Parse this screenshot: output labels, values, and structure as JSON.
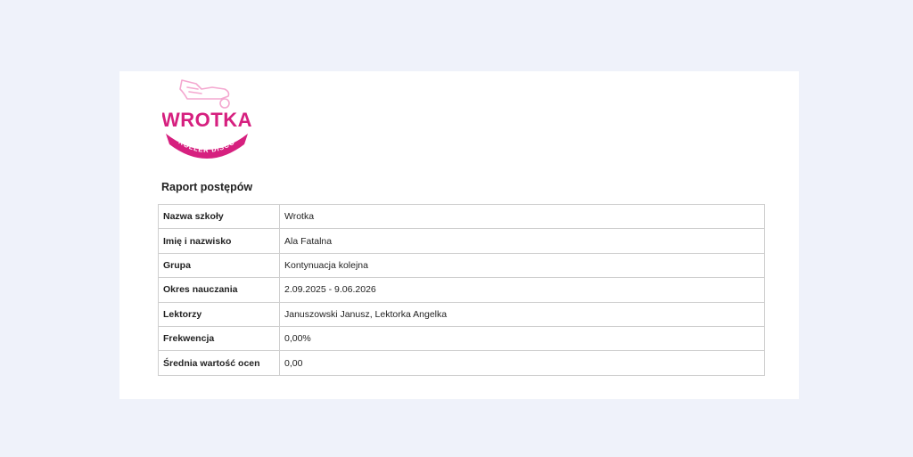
{
  "logo": {
    "brand": "WROTKA",
    "ribbon": "ROLLER DISCO",
    "color": "#d6207f",
    "icon": "roller-skate-icon"
  },
  "report": {
    "title": "Raport postępów",
    "rows": [
      {
        "label": "Nazwa szkoły",
        "value": "Wrotka"
      },
      {
        "label": "Imię i nazwisko",
        "value": "Ala Fatalna"
      },
      {
        "label": "Grupa",
        "value": "Kontynuacja kolejna"
      },
      {
        "label": "Okres nauczania",
        "value": "2.09.2025 - 9.06.2026"
      },
      {
        "label": "Lektorzy",
        "value": "Januszowski Janusz, Lektorka Angelka"
      },
      {
        "label": "Frekwencja",
        "value": "0,00%"
      },
      {
        "label": "Średnia wartość ocen",
        "value": "0,00"
      }
    ]
  }
}
